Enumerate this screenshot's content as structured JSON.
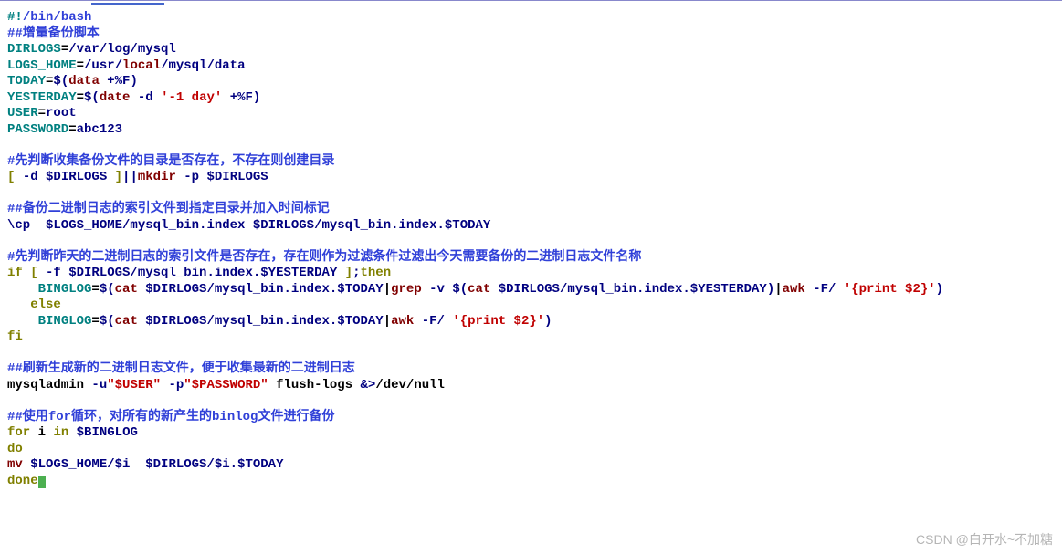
{
  "watermark": "CSDN @白开水~不加糖",
  "lines": [
    [
      [
        "c-teal",
        "#!"
      ],
      [
        "c-cmt",
        "/bin/bash"
      ]
    ],
    [
      [
        "c-cmt",
        "##增量备份脚本"
      ]
    ],
    [
      [
        "c-teal",
        "DIRLOGS"
      ],
      [
        "c-black",
        "="
      ],
      [
        "c-navy",
        "/var/log/mysql"
      ]
    ],
    [
      [
        "c-teal",
        "LOGS_HOME"
      ],
      [
        "c-black",
        "="
      ],
      [
        "c-navy",
        "/usr/"
      ],
      [
        "c-maroon",
        "local"
      ],
      [
        "c-navy",
        "/mysql/data"
      ]
    ],
    [
      [
        "c-teal",
        "TODAY"
      ],
      [
        "c-black",
        "="
      ],
      [
        "c-navy",
        "$("
      ],
      [
        "c-maroon",
        "data "
      ],
      [
        "c-navy",
        "+%F)"
      ]
    ],
    [
      [
        "c-teal",
        "YESTERDAY"
      ],
      [
        "c-black",
        "="
      ],
      [
        "c-navy",
        "$("
      ],
      [
        "c-maroon",
        "date "
      ],
      [
        "c-navy",
        "-d "
      ],
      [
        "c-red",
        "'-1 day'"
      ],
      [
        "c-navy",
        " +%F)"
      ]
    ],
    [
      [
        "c-teal",
        "USER"
      ],
      [
        "c-black",
        "="
      ],
      [
        "c-navy",
        "root"
      ]
    ],
    [
      [
        "c-teal",
        "PASSWORD"
      ],
      [
        "c-black",
        "="
      ],
      [
        "c-navy",
        "abc123"
      ]
    ],
    [
      [
        "",
        "　"
      ]
    ],
    [
      [
        "c-cmt",
        "#先判断收集备份文件的目录是否存在，不存在则创建目录"
      ]
    ],
    [
      [
        "c-olive",
        "[ "
      ],
      [
        "c-navy",
        "-d $DIRLOGS"
      ],
      [
        "c-olive",
        " ]"
      ],
      [
        "c-navy",
        "||"
      ],
      [
        "c-maroon",
        "mkdir "
      ],
      [
        "c-navy",
        "-p $DIRLOGS"
      ]
    ],
    [
      [
        "",
        "　"
      ]
    ],
    [
      [
        "c-cmt",
        "##备份二进制日志的索引文件到指定目录并加入时间标记"
      ]
    ],
    [
      [
        "c-navy",
        "\\cp  $LOGS_HOME"
      ],
      [
        "c-navy",
        "/mysql_bin.index $DIRLOGS"
      ],
      [
        "c-navy",
        "/mysql_bin.index.$TODAY"
      ]
    ],
    [
      [
        "",
        "　"
      ]
    ],
    [
      [
        "c-cmt",
        "#先判断昨天的二进制日志的索引文件是否存在，存在则作为过滤条件过滤出今天需要备份的二进制日志文件名称"
      ]
    ],
    [
      [
        "c-olive",
        "if [ "
      ],
      [
        "c-navy",
        "-f $DIRLOGS"
      ],
      [
        "c-navy",
        "/mysql_bin.index.$YESTERDAY"
      ],
      [
        "c-olive",
        " ]"
      ],
      [
        "c-navy",
        ";"
      ],
      [
        "c-olive",
        "then"
      ]
    ],
    [
      [
        "c-black",
        "    "
      ],
      [
        "c-teal",
        "BINGLOG"
      ],
      [
        "c-black",
        "="
      ],
      [
        "c-navy",
        "$("
      ],
      [
        "c-maroon",
        "cat "
      ],
      [
        "c-navy",
        "$DIRLOGS"
      ],
      [
        "c-navy",
        "/mysql_bin.index.$TODAY"
      ],
      [
        "c-black",
        "|"
      ],
      [
        "c-maroon",
        "grep "
      ],
      [
        "c-navy",
        "-v $("
      ],
      [
        "c-maroon",
        "cat "
      ],
      [
        "c-navy",
        "$DIRLOGS"
      ],
      [
        "c-navy",
        "/mysql_bin.index.$YESTERDAY"
      ],
      [
        "c-navy",
        ")"
      ],
      [
        "c-black",
        "|"
      ],
      [
        "c-maroon",
        "awk "
      ],
      [
        "c-navy",
        "-F/ "
      ],
      [
        "c-red",
        "'{print $2}'"
      ],
      [
        "c-navy",
        ")"
      ]
    ],
    [
      [
        "c-black",
        "   "
      ],
      [
        "c-olive",
        "else"
      ]
    ],
    [
      [
        "c-black",
        "    "
      ],
      [
        "c-teal",
        "BINGLOG"
      ],
      [
        "c-black",
        "="
      ],
      [
        "c-navy",
        "$("
      ],
      [
        "c-maroon",
        "cat "
      ],
      [
        "c-navy",
        "$DIRLOGS"
      ],
      [
        "c-navy",
        "/mysql_bin.index.$TODAY"
      ],
      [
        "c-black",
        "|"
      ],
      [
        "c-maroon",
        "awk "
      ],
      [
        "c-navy",
        "-F/ "
      ],
      [
        "c-red",
        "'{print $2}'"
      ],
      [
        "c-navy",
        ")"
      ]
    ],
    [
      [
        "c-olive",
        "fi"
      ]
    ],
    [
      [
        "",
        "　"
      ]
    ],
    [
      [
        "c-cmt",
        "##刷新生成新的二进制日志文件，便于收集最新的二进制日志"
      ]
    ],
    [
      [
        "c-black",
        "mysqladmin "
      ],
      [
        "c-navy",
        "-u"
      ],
      [
        "c-red",
        "\"$USER\""
      ],
      [
        "c-navy",
        " -p"
      ],
      [
        "c-red",
        "\"$PASSWORD\""
      ],
      [
        "c-black",
        " flush-logs "
      ],
      [
        "c-navy",
        "&>"
      ],
      [
        "c-black",
        "/dev/null"
      ]
    ],
    [
      [
        "",
        "　"
      ]
    ],
    [
      [
        "c-cmt",
        "##使用"
      ],
      [
        "c-cmt",
        "for"
      ],
      [
        "c-cmt",
        "循环，对所有的新产生的"
      ],
      [
        "c-cmt",
        "binlog"
      ],
      [
        "c-cmt",
        "文件进行备份"
      ]
    ],
    [
      [
        "c-olive",
        "for"
      ],
      [
        "c-black",
        " i "
      ],
      [
        "c-olive",
        "in "
      ],
      [
        "c-navy",
        "$BINGLOG"
      ]
    ],
    [
      [
        "c-olive",
        "do"
      ]
    ],
    [
      [
        "c-maroon",
        "mv "
      ],
      [
        "c-navy",
        "$LOGS_HOME"
      ],
      [
        "c-navy",
        "/$i  $DIRLOGS"
      ],
      [
        "c-navy",
        "/$i.$TODAY"
      ]
    ],
    [
      [
        "c-olive",
        "done"
      ],
      [
        "cursor",
        ""
      ]
    ]
  ]
}
